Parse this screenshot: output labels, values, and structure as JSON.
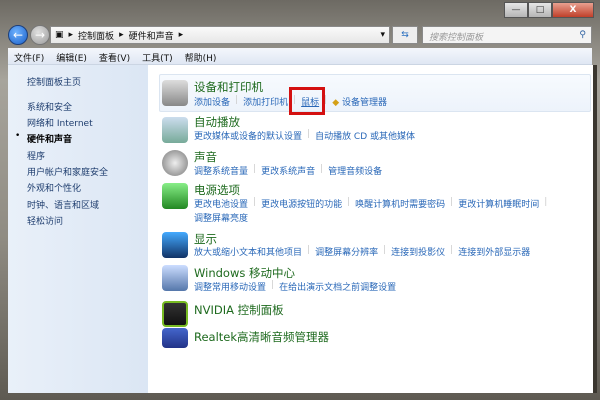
{
  "window": {
    "minimize": "—",
    "maximize": "□",
    "close": "X"
  },
  "address": {
    "crumbs": [
      "控制面板",
      "硬件和声音"
    ],
    "search_placeholder": "搜索控制面板"
  },
  "menu": [
    "文件(F)",
    "编辑(E)",
    "查看(V)",
    "工具(T)",
    "帮助(H)"
  ],
  "sidebar": {
    "home": "控制面板主页",
    "items": [
      "系统和安全",
      "网络和 Internet",
      "硬件和声音",
      "程序",
      "用户帐户和家庭安全",
      "外观和个性化",
      "时钟、语言和区域",
      "轻松访问"
    ],
    "current_index": 2
  },
  "sections": [
    {
      "title": "设备和打印机",
      "links": [
        "添加设备",
        "添加打印机",
        "鼠标",
        "设备管理器"
      ]
    },
    {
      "title": "自动播放",
      "links": [
        "更改媒体或设备的默认设置",
        "自动播放 CD 或其他媒体"
      ]
    },
    {
      "title": "声音",
      "links": [
        "调整系统音量",
        "更改系统声音",
        "管理音频设备"
      ]
    },
    {
      "title": "电源选项",
      "links": [
        "更改电池设置",
        "更改电源按钮的功能",
        "唤醒计算机时需要密码",
        "更改计算机睡眠时间"
      ],
      "links2": [
        "调整屏幕亮度"
      ]
    },
    {
      "title": "显示",
      "links": [
        "放大或缩小文本和其他项目",
        "调整屏幕分辨率",
        "连接到投影仪",
        "连接到外部显示器"
      ]
    },
    {
      "title": "Windows 移动中心",
      "links": [
        "调整常用移动设置",
        "在给出演示文档之前调整设置"
      ]
    },
    {
      "title": "NVIDIA 控制面板",
      "links": []
    },
    {
      "title": "Realtek高清晰音频管理器",
      "links": []
    }
  ],
  "colors": {
    "title": "#1e6a1e",
    "link": "#2a68b8",
    "highlight": "#d41010"
  }
}
